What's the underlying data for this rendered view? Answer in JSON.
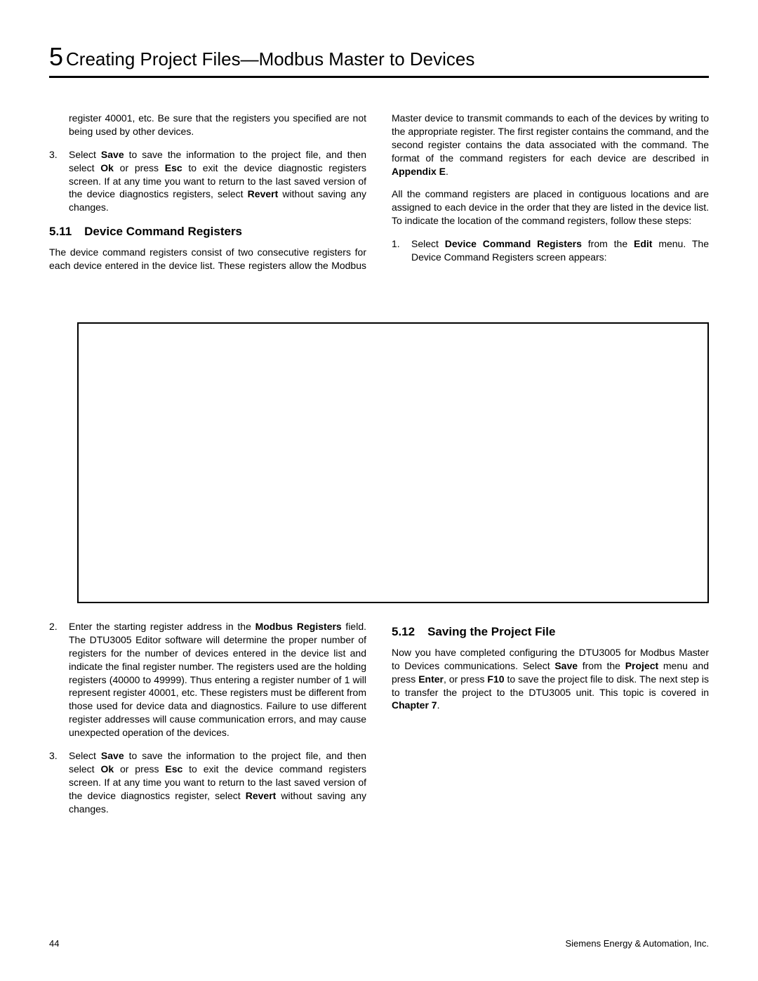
{
  "header": {
    "chapter_num": "5",
    "title": "Creating Project Files—Modbus Master to Devices"
  },
  "upper": {
    "intro_para": "register 40001, etc. Be sure that the registers you specified are not being used by other devices.",
    "item3_pre": "Select ",
    "item3_b1": "Save",
    "item3_mid1": " to save the information to the project file, and then select ",
    "item3_b2": "Ok",
    "item3_mid2": " or press ",
    "item3_b3": "Esc",
    "item3_mid3": " to exit the device diagnostic registers screen. If at any time you want to return to the last saved version of the device diagnostics registers, select ",
    "item3_b4": "Revert",
    "item3_post": " without saving any changes.",
    "section511_num": "5.11",
    "section511_title": "Device Command Registers",
    "section511_p1a": "The device command registers consist of two consecutive registers for each device entered in the device list. These registers allow the Modbus Master device to transmit commands to each of the devices by writ",
    "section511_p1b": "ing to the appropriate register. The first register contains the command, and the second register contains the data associated with the command. The format of the command registers for each device are described in ",
    "appendix_e": "Appendix E",
    "period": ".",
    "section511_p2": "All the command registers are placed in contiguous locations and are assigned to each device in the order that they are listed in the device list. To indicate the location of the command registers, follow these steps:",
    "item1_pre": "Select ",
    "item1_b1": "Device Command Registers",
    "item1_mid": " from the ",
    "item1_b2": "Edit",
    "item1_post": " menu. The Device Command Registers screen appears:"
  },
  "lower": {
    "item2_pre": "Enter the starting register address in the ",
    "item2_b1": "Modbus Registers",
    "item2_post": " field. The DTU3005 Editor software will determine the proper number of registers for the number of devices entered in the device list and indicate the final register number. The registers used are the holding registers (40000 to 49999). Thus entering a register number of 1 will represent register 40001, etc. These registers must be different from those used for device data and diagnostics. Failure to use different register addresses will cause communication errors, and may cause unexpected operation of the devices.",
    "item3_pre": "Select ",
    "item3_b1": "Save",
    "item3_mid1": " to save the information to the project file, and then select ",
    "item3_b2": "Ok",
    "item3_mid2": " or press ",
    "item3_b3": "Esc",
    "item3_mid3": " to exit the device command registers screen. If at any time you want to return to the last saved version of the device diagnostics register, select ",
    "item3_b4": "Revert",
    "item3_post": " without saving any changes.",
    "section512_num": "5.12",
    "section512_title": "Saving the Project File",
    "p512_pre": "Now you have completed configuring the DTU3005 for Modbus Master to Devices communications. Select ",
    "p512_b1": "Save",
    "p512_mid1": " from the ",
    "p512_b2": "Project",
    "p512_mid2": " menu and press ",
    "p512_b3": "Enter",
    "p512_mid3": ", or press ",
    "p512_b4": "F10",
    "p512_mid4": " to save the project file to disk. The next step is to transfer the project to the DTU3005 unit. This topic is covered in ",
    "p512_b5": "Chapter 7",
    "p512_post": "."
  },
  "footer": {
    "page_num": "44",
    "company": "Siemens Energy & Automation, Inc."
  },
  "nums": {
    "n1": "1.",
    "n2": "2.",
    "n3": "3."
  }
}
